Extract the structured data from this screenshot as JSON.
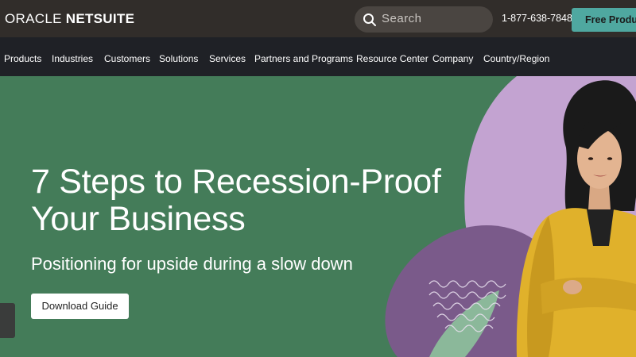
{
  "header": {
    "logo_part1": "ORACLE",
    "logo_part2": "NETSUITE",
    "search_placeholder": "Search",
    "phone": "1-877-638-7848",
    "cta_label": "Free Product Tour"
  },
  "nav": {
    "items": [
      "Products",
      "Industries",
      "Customers",
      "Solutions",
      "Services",
      "Partners and Programs",
      "Resource Center",
      "Company",
      "Country/Region"
    ]
  },
  "hero": {
    "headline_line1": "7 Steps to Recession-Proof",
    "headline_line2": "Your Business",
    "subheadline": "Positioning for upside during a slow down",
    "button_label": "Download Guide"
  },
  "colors": {
    "top_bar": "#312d2a",
    "nav_bar": "#1f2126",
    "hero_background": "#447c59",
    "cta_accent": "#4fa8a0",
    "lavender_shape": "#c3a3d1",
    "purple_shape": "#7a5a8a",
    "jacket": "#e0b12b"
  },
  "icons": [
    "search-icon"
  ]
}
